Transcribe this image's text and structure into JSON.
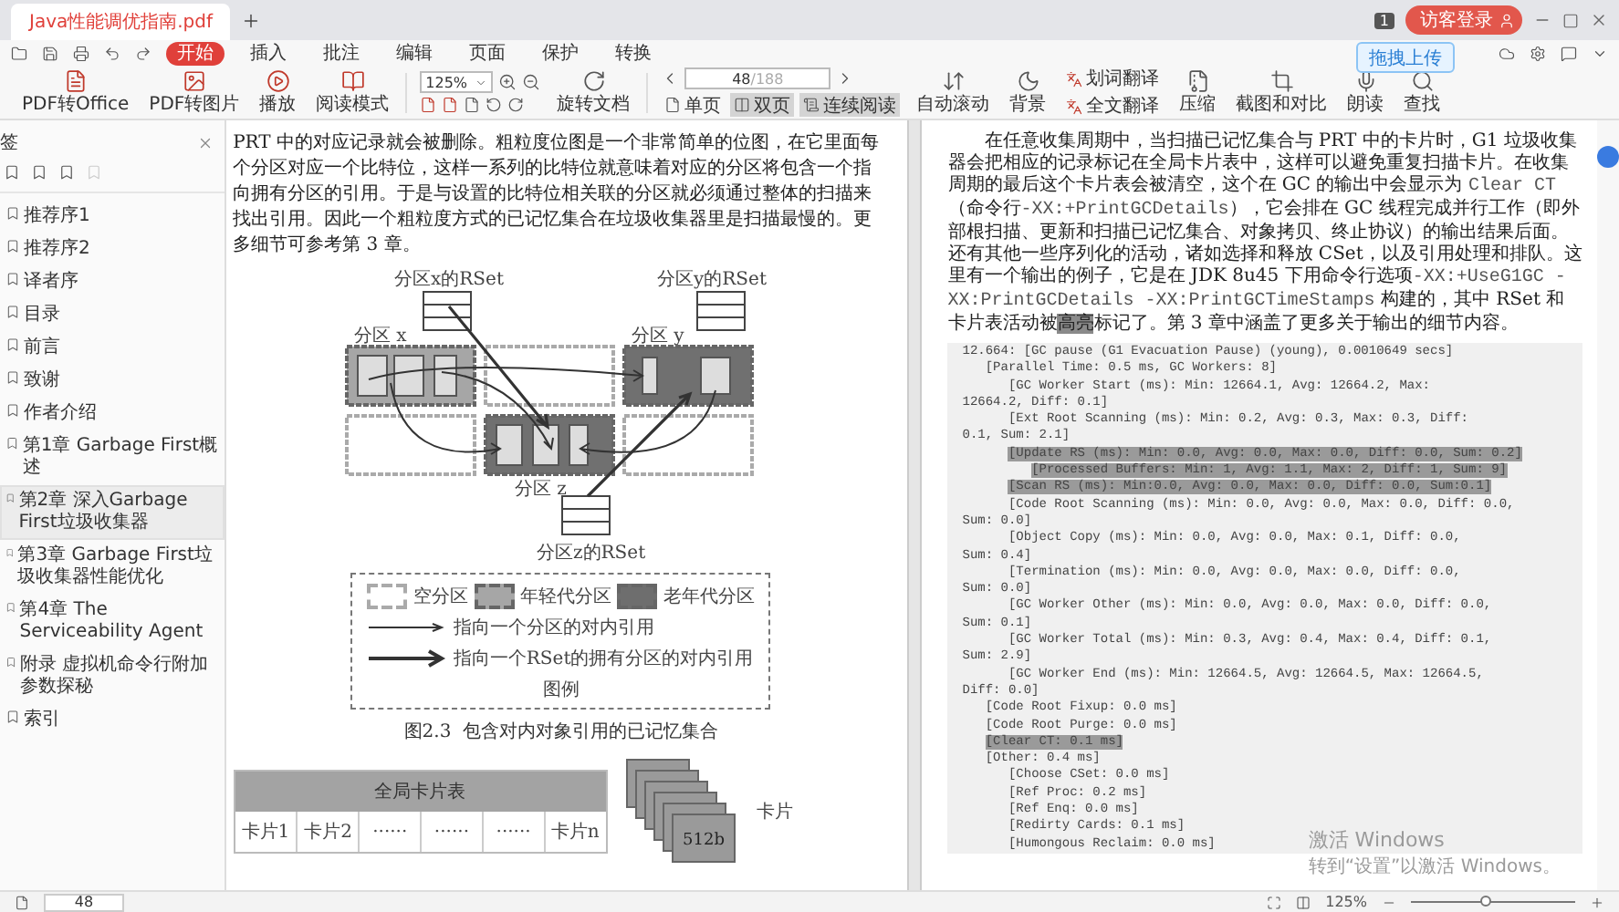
{
  "tab_bar": {
    "document_title": "Java性能调优指南.pdf",
    "badge": "1",
    "login_button": "访客登录"
  },
  "menu_bar": {
    "tabs": [
      {
        "label": "开始",
        "selected": true
      },
      {
        "label": "插入",
        "selected": false
      },
      {
        "label": "批注",
        "selected": false
      },
      {
        "label": "编辑",
        "selected": false
      },
      {
        "label": "页面",
        "selected": false
      },
      {
        "label": "保护",
        "selected": false
      },
      {
        "label": "转换",
        "selected": false
      }
    ],
    "upload_button": "拖拽上传"
  },
  "toolbar": {
    "convert_buttons": [
      "PDF转Office",
      "PDF转图片",
      "播放",
      "阅读模式"
    ],
    "zoom": {
      "value": "125%"
    },
    "rotate_button": "旋转文档",
    "pager": {
      "value": "48",
      "total": "/188"
    },
    "view_buttons": [
      {
        "label": "单页",
        "selected": false
      },
      {
        "label": "双页",
        "selected": true
      },
      {
        "label": "连续阅读",
        "selected": true
      }
    ],
    "tool_buttons": [
      "自动滚动",
      "背景"
    ],
    "translate_buttons": [
      "划词翻译",
      "全文翻译"
    ],
    "extra_buttons": [
      "压缩",
      "截图和对比",
      "朗读",
      "查找"
    ]
  },
  "sidebar": {
    "title": "签",
    "items": [
      {
        "label": "推荐序1",
        "selected": false
      },
      {
        "label": "推荐序2",
        "selected": false
      },
      {
        "label": "译者序",
        "selected": false
      },
      {
        "label": "目录",
        "selected": false
      },
      {
        "label": "前言",
        "selected": false
      },
      {
        "label": "致谢",
        "selected": false
      },
      {
        "label": "作者介绍",
        "selected": false
      },
      {
        "label": "第1章 Garbage First概述",
        "selected": false
      },
      {
        "label": "第2章 深入Garbage First垃圾收集器",
        "selected": true
      },
      {
        "label": "第3章 Garbage First垃圾收集器性能优化",
        "selected": false
      },
      {
        "label": "第4章 The Serviceability Agent",
        "selected": false
      },
      {
        "label": "附录 虚拟机命令行附加参数探秘",
        "selected": false
      },
      {
        "label": "索引",
        "selected": false
      }
    ]
  },
  "left_page": {
    "paragraph": "PRT 中的对应记录就会被删除。粗粒度位图是一个非常简单的位图，在它里面每个分区对应一个比特位，这样一系列的比特位就意味着对应的分区将包含一个指向拥有分区的引用。于是与设置的比特位相关联的分区就必须通过整体的扫描来找出引用。因此一个粗粒度方式的已记忆集合在垃圾收集器里是扫描最慢的。更多细节可参考第 3 章。",
    "figure": {
      "regions": [
        {
          "kind": "young",
          "label": "分区 x"
        },
        {
          "kind": "empty"
        },
        {
          "kind": "old",
          "label": "分区 y"
        },
        {
          "kind": "empty"
        },
        {
          "kind": "old",
          "label": "分区 z"
        },
        {
          "kind": "empty"
        }
      ],
      "rsets": [
        "分区x的RSet",
        "分区y的RSet",
        "分区z的RSet"
      ],
      "legend": {
        "swatches": [
          {
            "kind": "empty",
            "label": "空分区"
          },
          {
            "kind": "young",
            "label": "年轻代分区"
          },
          {
            "kind": "old",
            "label": "老年代分区"
          }
        ],
        "arrows": [
          {
            "kind": "thin",
            "label": "指向一个分区的对内引用"
          },
          {
            "kind": "thick",
            "label": "指向一个RSet的拥有分区的对内引用"
          }
        ],
        "title": "图例"
      },
      "caption": "图2.3  包含对内对象引用的已记忆集合"
    },
    "card_table": {
      "title": "全局卡片表",
      "cells": [
        "卡片1",
        "卡片2",
        "······",
        "······",
        "······",
        "卡片n"
      ]
    },
    "card_stack": {
      "card_label": "512b",
      "label": "卡片"
    }
  },
  "right_page": {
    "paragraph": [
      {
        "kind": "text",
        "text": "在任意收集周期中，当扫描已记忆集合与 PRT 中的卡片时，G1 垃圾收集器会把相应的记录标记在全局卡片表中，这样可以避免重复扫描卡片。在收集周期的最后这个卡片表会被清空，这个在 GC 的输出中会显示为 "
      },
      {
        "kind": "code",
        "text": "Clear CT"
      },
      {
        "kind": "text",
        "text": "（命令行"
      },
      {
        "kind": "code",
        "text": "-XX:+PrintGCDetails"
      },
      {
        "kind": "text",
        "text": "），它会排在 GC 线程完成并行工作（即外部根扫描、更新和扫描已记忆集合、对象拷贝、终止协议）的输出结果后面。还有其他一些序列化的活动，诸如选择和释放 CSet，以及引用处理和排队。这里有一个输出的例子，它是在 JDK 8u45 下用命令行选项"
      },
      {
        "kind": "code",
        "text": "-XX:+UseG1GC -XX:PrintGCDetails -XX:PrintGCTimeStamps"
      },
      {
        "kind": "text",
        "text": " 构建的，其中 RSet 和卡片表活动被"
      },
      {
        "kind": "highlight",
        "text": "高亮"
      },
      {
        "kind": "text",
        "text": "标记了。第 3 章中涵盖了更多关于输出的细节内容。"
      }
    ],
    "code_lines": [
      {
        "text": "12.664: [GC pause (G1 Evacuation Pause) (young), 0.0010649 secs]",
        "highlighted": false
      },
      {
        "text": "   [Parallel Time: 0.5 ms, GC Workers: 8]",
        "highlighted": false
      },
      {
        "text": "      [GC Worker Start (ms): Min: 12664.1, Avg: 12664.2, Max:",
        "highlighted": false
      },
      {
        "text": "12664.2, Diff: 0.1]",
        "highlighted": false
      },
      {
        "text": "      [Ext Root Scanning (ms): Min: 0.2, Avg: 0.3, Max: 0.3, Diff:",
        "highlighted": false
      },
      {
        "text": "0.1, Sum: 2.1]",
        "highlighted": false
      },
      {
        "text": "      [Update RS (ms): Min: 0.0, Avg: 0.0, Max: 0.0, Diff: 0.0, Sum: 0.2]",
        "highlighted": true
      },
      {
        "text": "         [Processed Buffers: Min: 1, Avg: 1.1, Max: 2, Diff: 1, Sum: 9]",
        "highlighted": true
      },
      {
        "text": "      [Scan RS (ms): Min:0.0, Avg: 0.0, Max: 0.0, Diff: 0.0, Sum:0.1]",
        "highlighted": true
      },
      {
        "text": "      [Code Root Scanning (ms): Min: 0.0, Avg: 0.0, Max: 0.0, Diff: 0.0,",
        "highlighted": false
      },
      {
        "text": "Sum: 0.0]",
        "highlighted": false
      },
      {
        "text": "      [Object Copy (ms): Min: 0.0, Avg: 0.0, Max: 0.1, Diff: 0.0,",
        "highlighted": false
      },
      {
        "text": "Sum: 0.4]",
        "highlighted": false
      },
      {
        "text": "      [Termination (ms): Min: 0.0, Avg: 0.0, Max: 0.0, Diff: 0.0,",
        "highlighted": false
      },
      {
        "text": "Sum: 0.0]",
        "highlighted": false
      },
      {
        "text": "      [GC Worker Other (ms): Min: 0.0, Avg: 0.0, Max: 0.0, Diff: 0.0,",
        "highlighted": false
      },
      {
        "text": "Sum: 0.1]",
        "highlighted": false
      },
      {
        "text": "      [GC Worker Total (ms): Min: 0.3, Avg: 0.4, Max: 0.4, Diff: 0.1,",
        "highlighted": false
      },
      {
        "text": "Sum: 2.9]",
        "highlighted": false
      },
      {
        "text": "      [GC Worker End (ms): Min: 12664.5, Avg: 12664.5, Max: 12664.5,",
        "highlighted": false
      },
      {
        "text": "Diff: 0.0]",
        "highlighted": false
      },
      {
        "text": "   [Code Root Fixup: 0.0 ms]",
        "highlighted": false
      },
      {
        "text": "   [Code Root Purge: 0.0 ms]",
        "highlighted": false
      },
      {
        "text": "   [Clear CT: 0.1 ms]",
        "highlighted": true
      },
      {
        "text": "   [Other: 0.4 ms]",
        "highlighted": false
      },
      {
        "text": "      [Choose CSet: 0.0 ms]",
        "highlighted": false
      },
      {
        "text": "      [Ref Proc: 0.2 ms]",
        "highlighted": false
      },
      {
        "text": "      [Ref Enq: 0.0 ms]",
        "highlighted": false
      },
      {
        "text": "      [Redirty Cards: 0.1 ms]",
        "highlighted": false
      },
      {
        "text": "      [Humongous Reclaim: 0.0 ms]",
        "highlighted": false
      }
    ]
  },
  "status_bar": {
    "page": "48",
    "zoom": "125%",
    "zoom_slider": {
      "level": 0.45
    }
  },
  "activation_notice": {
    "title": "激活 Windows",
    "subtitle": "转到“设置”以激活 Windows。"
  }
}
